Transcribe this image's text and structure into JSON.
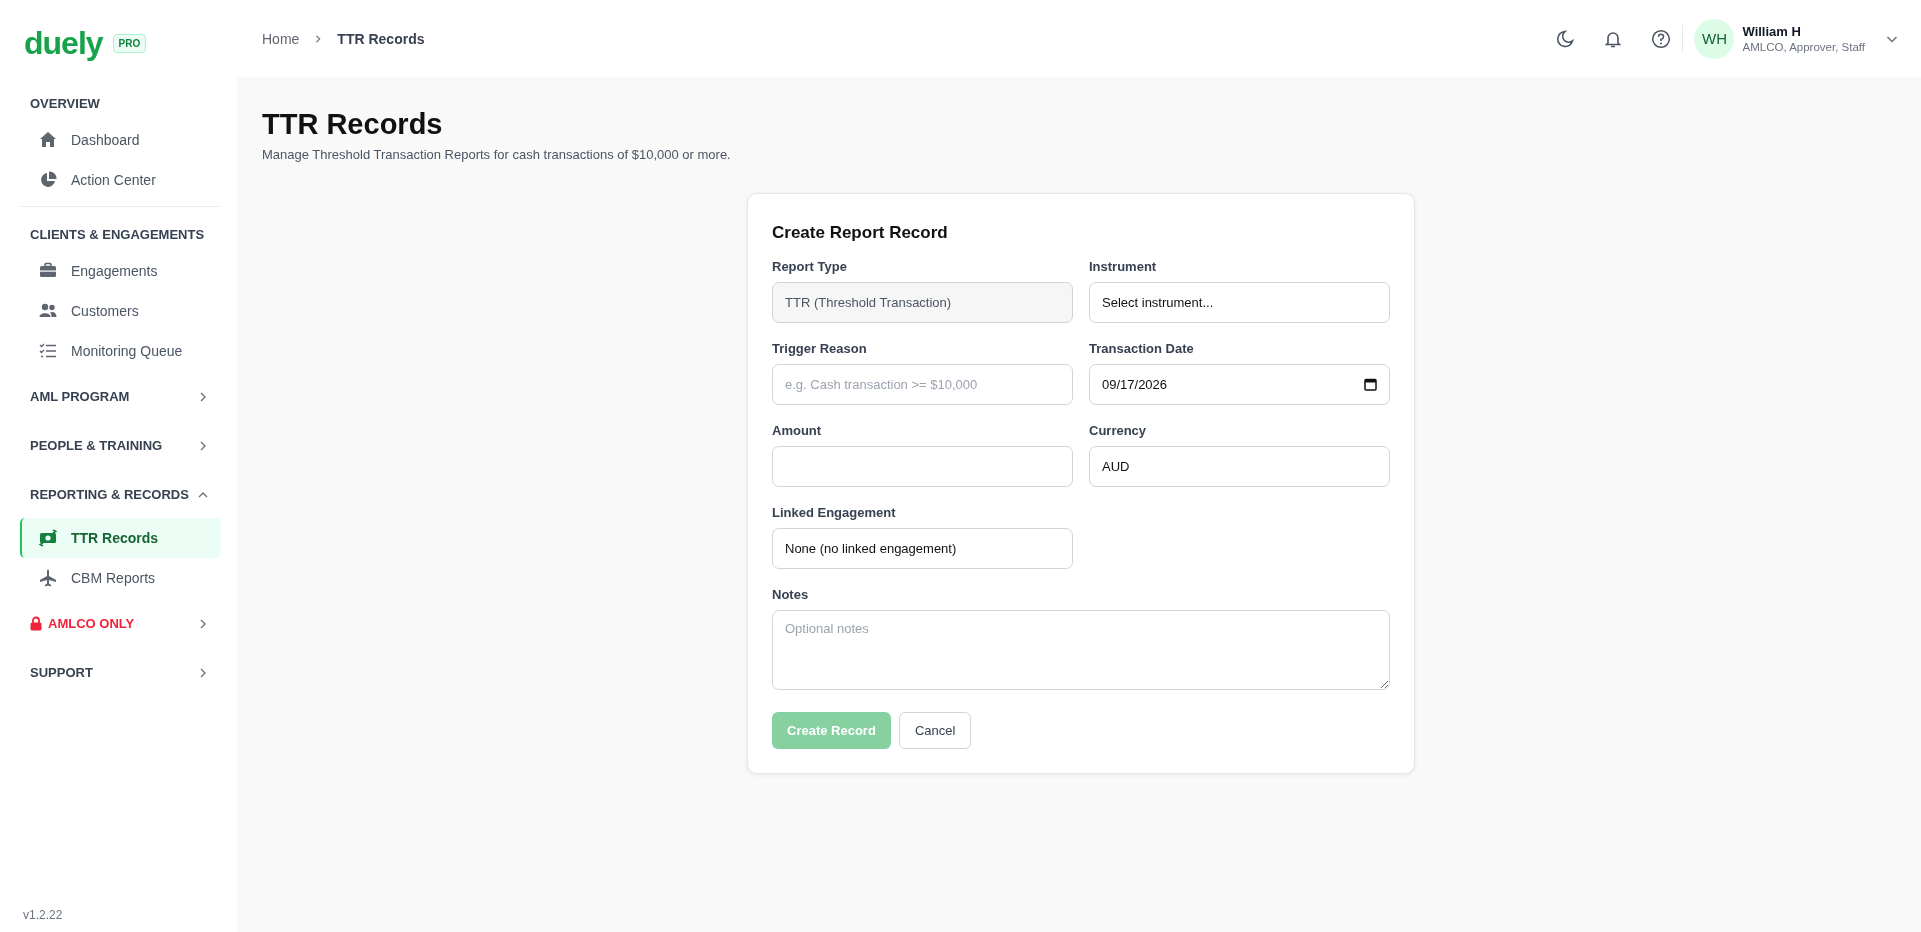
{
  "sidebar": {
    "logo": "duely",
    "badge": "PRO",
    "sections": [
      {
        "title": "OVERVIEW",
        "kind": "static",
        "items": [
          {
            "label": "Dashboard",
            "selected": false
          },
          {
            "label": "Action Center",
            "selected": false
          }
        ]
      },
      {
        "title": "CLIENTS & ENGAGEMENTS",
        "kind": "static",
        "items": [
          {
            "label": "Engagements",
            "selected": false
          },
          {
            "label": "Customers",
            "selected": false
          },
          {
            "label": "Monitoring Queue",
            "selected": false
          }
        ]
      },
      {
        "title": "AML PROGRAM",
        "kind": "group",
        "expanded": false
      },
      {
        "title": "PEOPLE & TRAINING",
        "kind": "group",
        "expanded": false
      },
      {
        "title": "REPORTING & RECORDS",
        "kind": "group",
        "expanded": true,
        "items": [
          {
            "label": "TTR Records",
            "selected": true
          },
          {
            "label": "CBM Reports",
            "selected": false
          }
        ]
      },
      {
        "title": "AMLCO ONLY",
        "kind": "restricted",
        "expanded": false
      },
      {
        "title": "SUPPORT",
        "kind": "group",
        "expanded": false
      }
    ],
    "version": "v1.2.22"
  },
  "breadcrumbs": [
    "Home",
    "TTR Records"
  ],
  "user": {
    "initials": "WH",
    "name": "William H",
    "roles": "AMLCO, Approver, Staff"
  },
  "page": {
    "title": "TTR Records",
    "subtitle": "Manage Threshold Transaction Reports for cash transactions of $10,000 or more."
  },
  "form": {
    "title": "Create Report Record",
    "fields": [
      {
        "label": "Report Type",
        "kind": "readonly",
        "value": "TTR (Threshold Transaction)"
      },
      {
        "label": "Instrument",
        "kind": "select",
        "value": "Select instrument..."
      },
      {
        "label": "Trigger Reason",
        "kind": "text",
        "placeholder": "e.g. Cash transaction >= $10,000"
      },
      {
        "label": "Transaction Date",
        "kind": "date",
        "value": "09/17/2026"
      },
      {
        "label": "Amount",
        "kind": "text"
      },
      {
        "label": "Currency",
        "kind": "select",
        "value": "AUD"
      },
      {
        "label": "Linked Engagement",
        "kind": "select",
        "value": "None (no linked engagement)"
      },
      {
        "label": "Notes",
        "kind": "textarea",
        "placeholder": "Optional notes"
      }
    ],
    "buttons": [
      {
        "label": "Create Record",
        "kind": "primary",
        "disabled": true
      },
      {
        "label": "Cancel",
        "kind": "secondary",
        "disabled": false
      }
    ]
  }
}
